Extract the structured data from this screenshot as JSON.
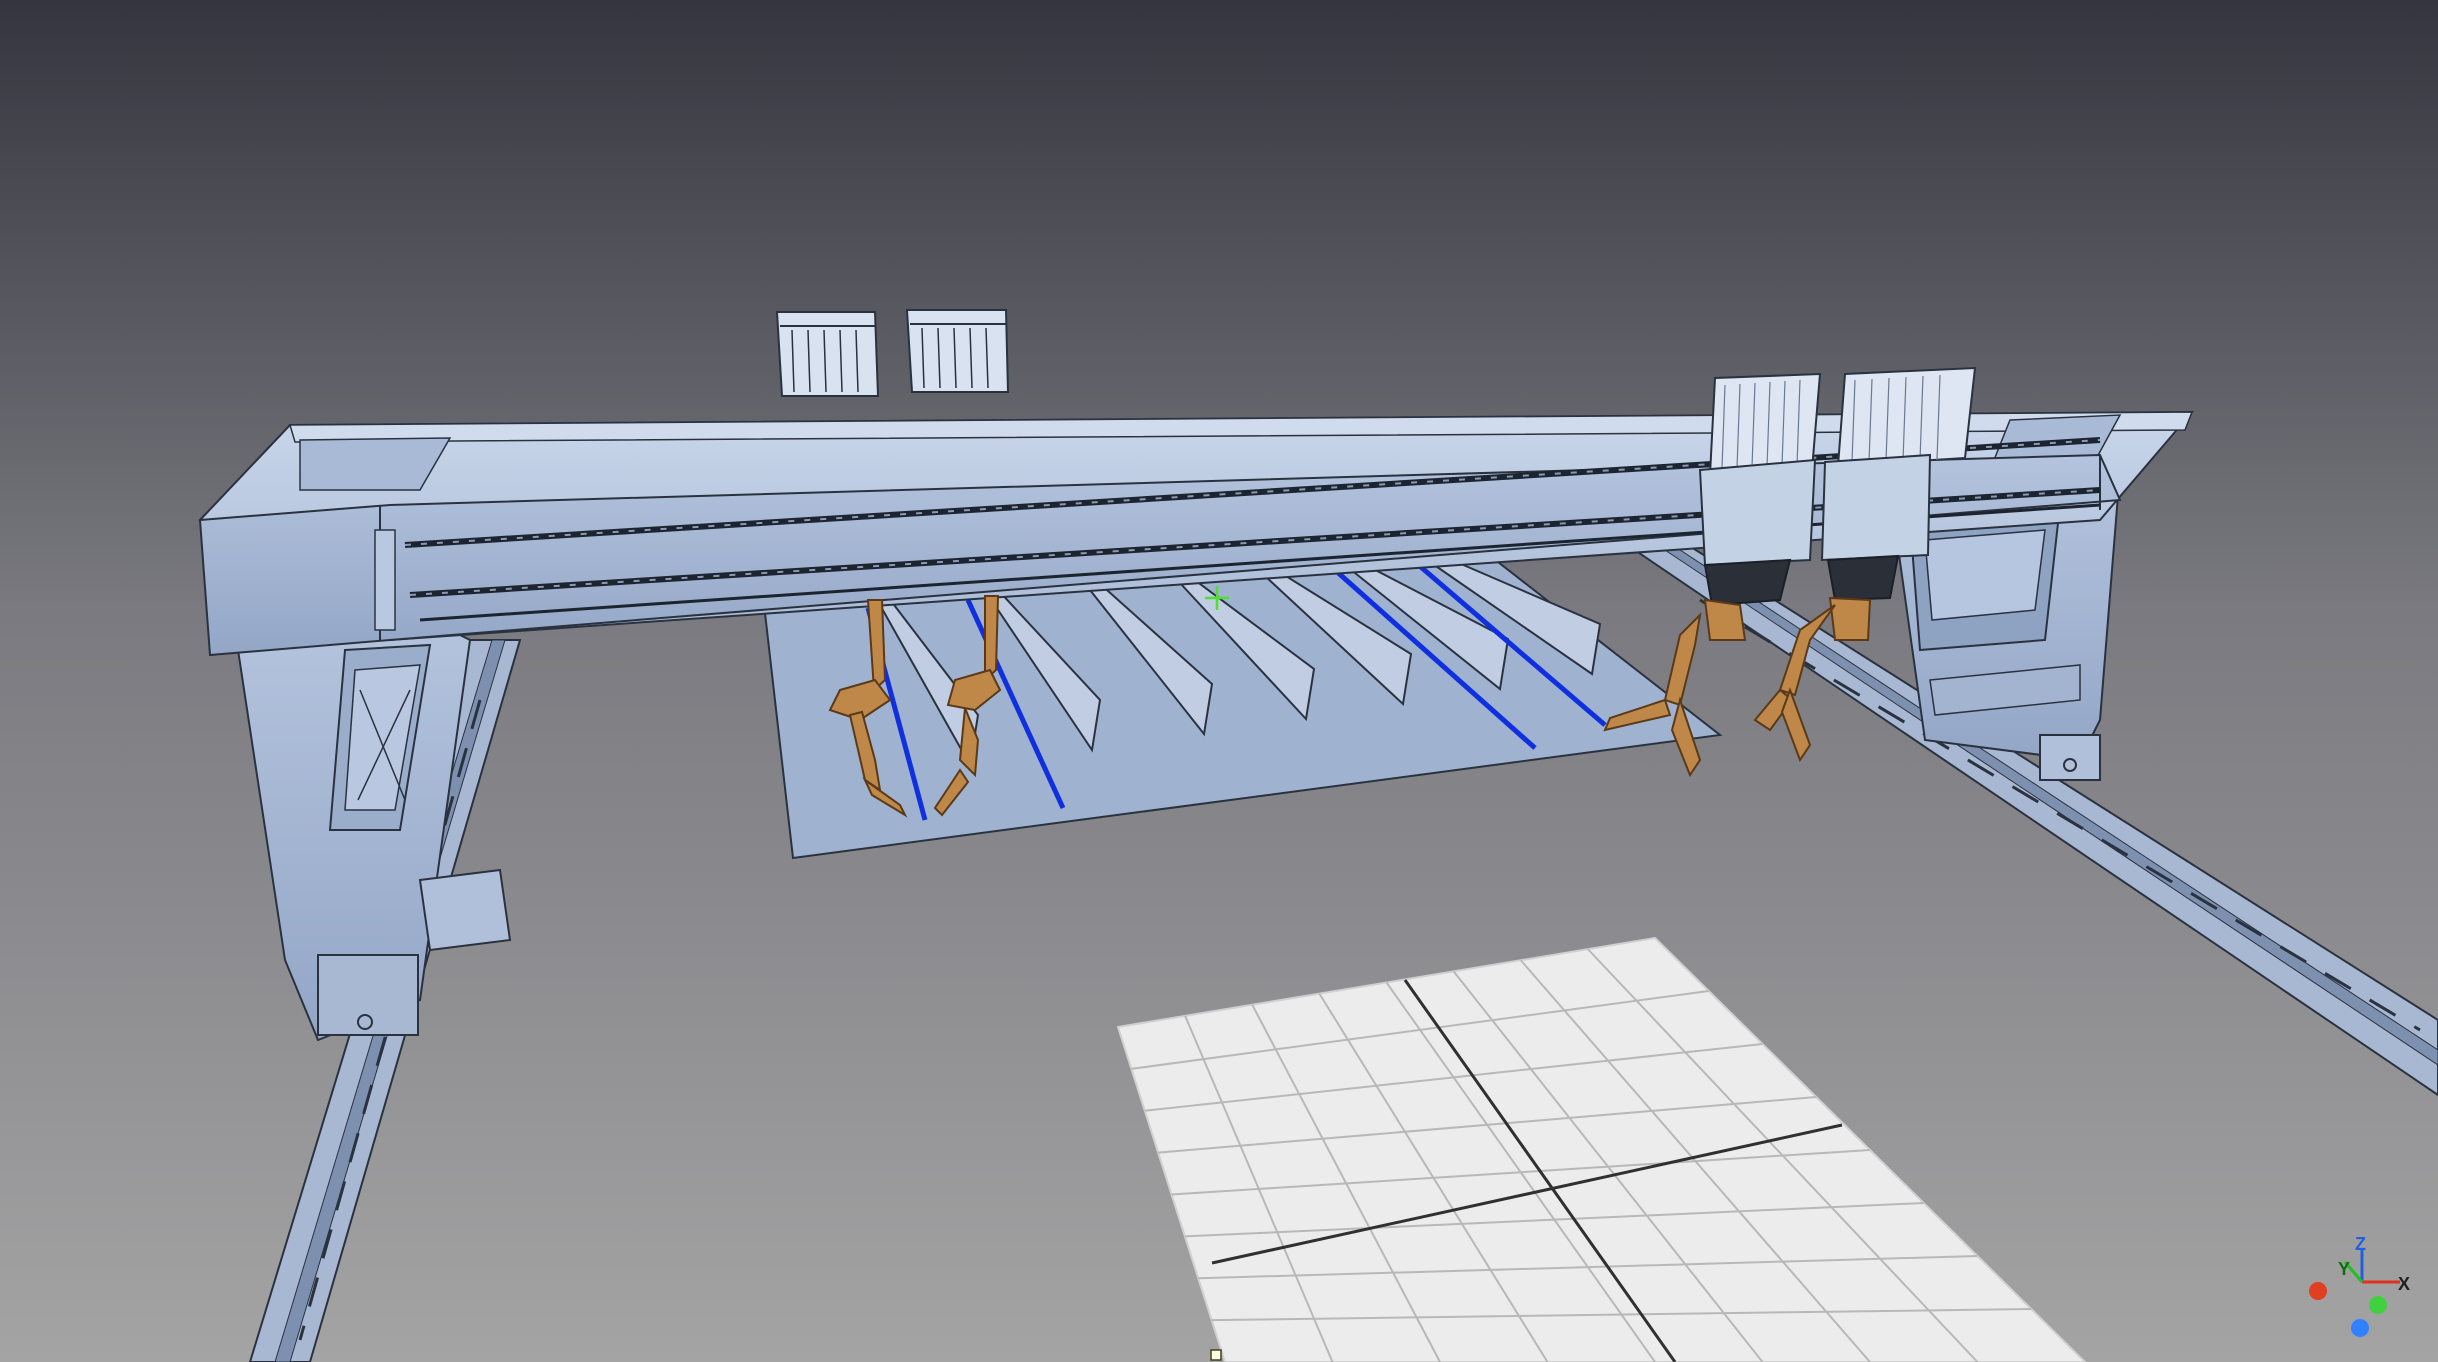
{
  "viewport": {
    "background_top": "#3a3a46",
    "background_bottom": "#a0a0a0",
    "model_color": "#b8c8e0",
    "model_edge": "#2a3240",
    "robot_color": "#c08848",
    "weld_path_color": "#1030e0",
    "grid_color": "#f0f0f0"
  },
  "axis_triad": {
    "x_label": "X",
    "y_label": "Y",
    "z_label": "Z",
    "x_color": "#e03020",
    "y_color": "#20c020",
    "z_color": "#2060e0"
  }
}
